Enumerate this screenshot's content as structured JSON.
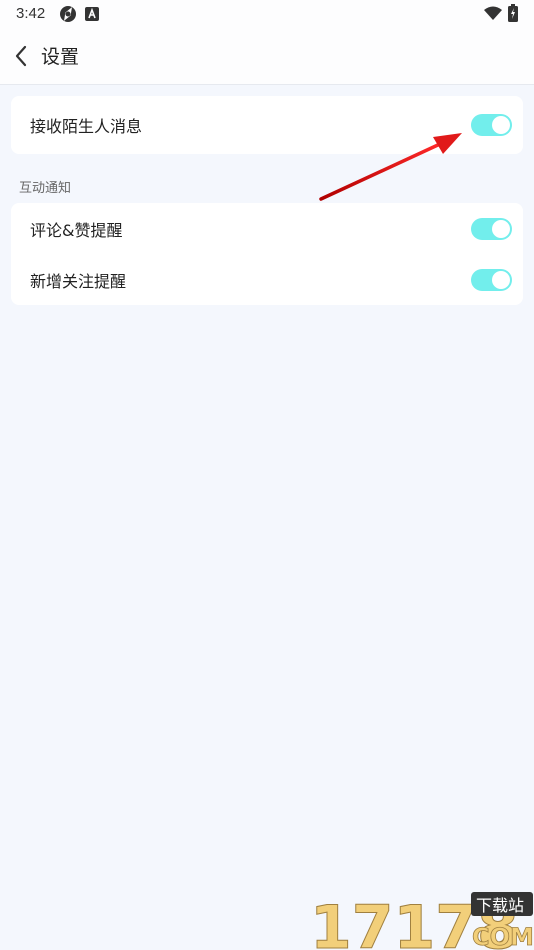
{
  "status_bar": {
    "time": "3:42",
    "left_icons": [
      "aperture-icon",
      "a-square-icon"
    ],
    "right_icons": [
      "wifi-icon",
      "battery-charging-icon"
    ]
  },
  "header": {
    "back_icon": "chevron-left-icon",
    "title": "设置"
  },
  "stranger_card": {
    "label": "接收陌生人消息",
    "enabled": true
  },
  "interaction_section": {
    "title": "互动通知",
    "items": [
      {
        "label": "评论&赞提醒",
        "enabled": true
      },
      {
        "label": "新增关注提醒",
        "enabled": true
      }
    ]
  },
  "colors": {
    "background": "#f4f7fd",
    "toggle_on": "#72eeec",
    "annotation_arrow": "#e11a1a"
  },
  "watermark": {
    "number": "17178",
    "domain": "COM",
    "tag": "下载站"
  }
}
